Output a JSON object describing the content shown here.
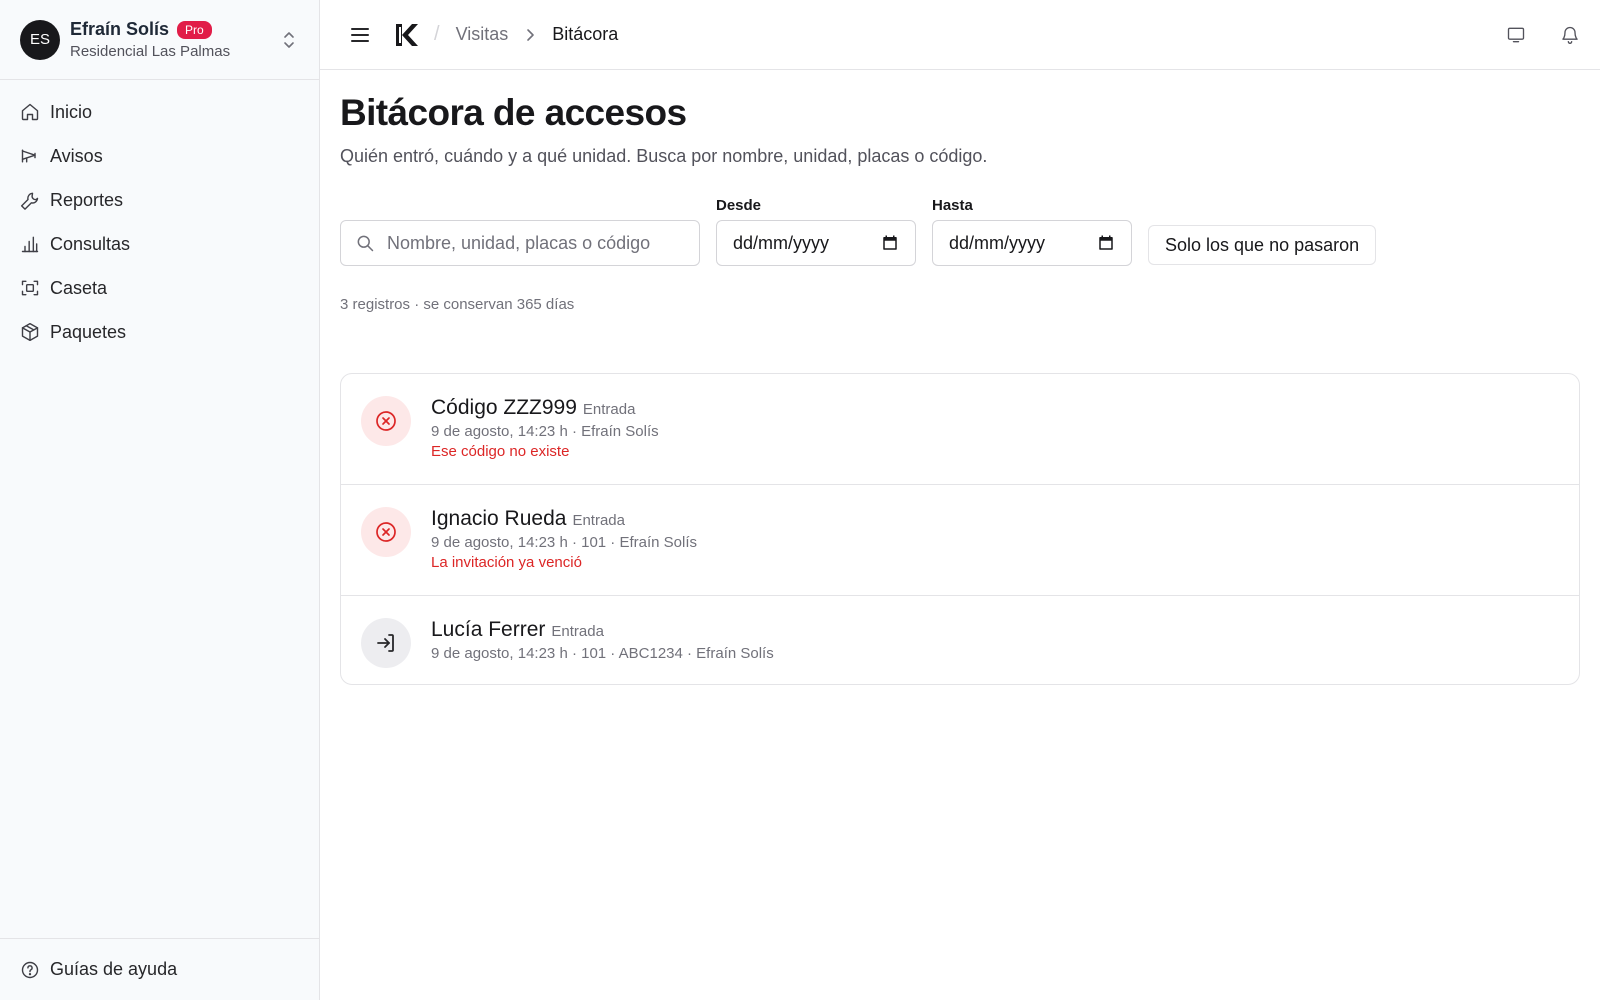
{
  "account": {
    "initials": "ES",
    "name": "Efraín Solís",
    "plan_badge": "Pro",
    "community": "Residencial Las Palmas"
  },
  "sidebar": {
    "items": [
      {
        "label": "Inicio",
        "icon": "home-icon"
      },
      {
        "label": "Avisos",
        "icon": "megaphone-icon"
      },
      {
        "label": "Reportes",
        "icon": "wrench-icon"
      },
      {
        "label": "Consultas",
        "icon": "bar-chart-icon"
      },
      {
        "label": "Caseta",
        "icon": "scan-icon"
      },
      {
        "label": "Paquetes",
        "icon": "package-icon"
      }
    ],
    "footer_label": "Guías de ayuda"
  },
  "breadcrumb": {
    "parent": "Visitas",
    "current": "Bitácora"
  },
  "page": {
    "title": "Bitácora de accesos",
    "subtitle": "Quién entró, cuándo y a qué unidad. Busca por nombre, unidad, placas o código."
  },
  "filters": {
    "search_placeholder": "Nombre, unidad, placas o código",
    "from_label": "Desde",
    "from_value": "dd/mm/yyyy",
    "to_label": "Hasta",
    "to_value": "dd/mm/yyyy",
    "toggle_label": "Solo los que no pasaron"
  },
  "summary": "3 registros · se conservan 365 días",
  "records": [
    {
      "name": "Código ZZZ999",
      "type": "Entrada",
      "meta": "9 de agosto, 14:23 h · Efraín Solís",
      "error": "Ese código no existe",
      "status": "denied",
      "icon": "x-circle-icon"
    },
    {
      "name": "Ignacio Rueda",
      "type": "Entrada",
      "meta": "9 de agosto, 14:23 h · 101 · Efraín Solís",
      "error": "La invitación ya venció",
      "status": "denied",
      "icon": "x-circle-icon"
    },
    {
      "name": "Lucía Ferrer",
      "type": "Entrada",
      "meta": "9 de agosto, 14:23 h · 101 · ABC1234 · Efraín Solís",
      "error": "",
      "status": "allowed",
      "icon": "log-in-icon"
    }
  ],
  "colors": {
    "badge": "#e11d48",
    "error": "#dc2626",
    "error_bg": "#fde8e8",
    "ok_bg": "#ededf0"
  }
}
